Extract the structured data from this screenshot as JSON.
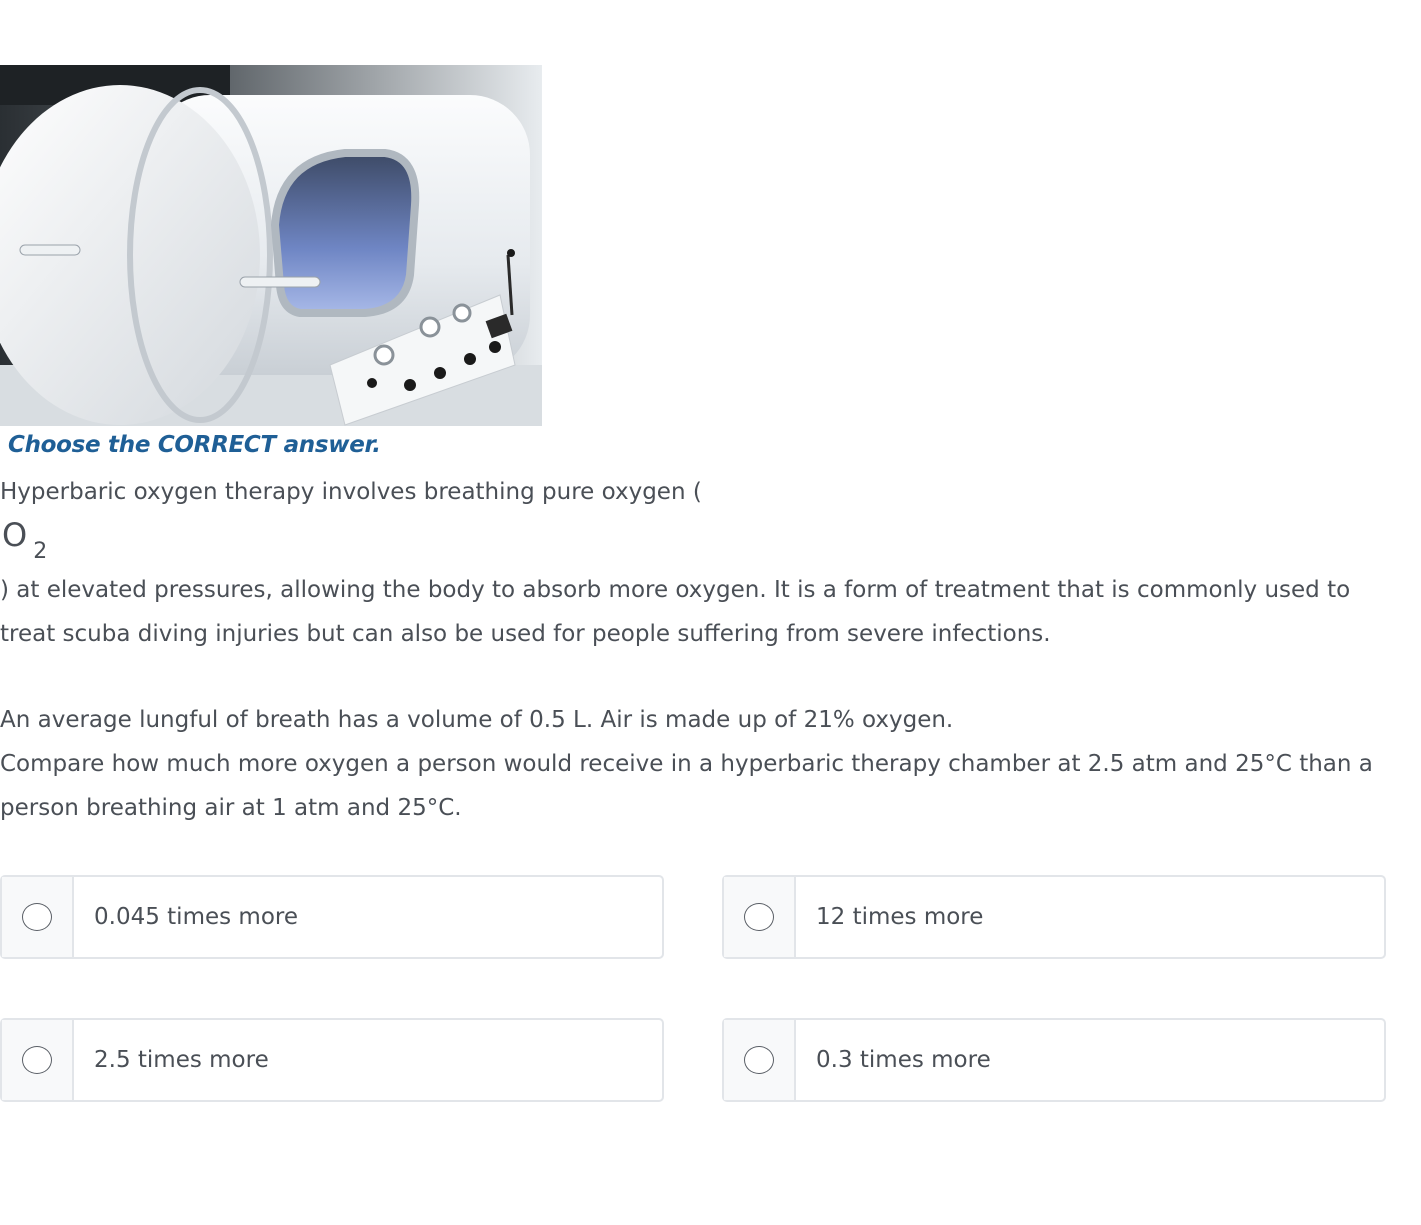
{
  "image": {
    "alt": "hyperbaric-chamber-photo"
  },
  "question": {
    "instruction": "Choose the CORRECT answer.",
    "intro": "Hyperbaric oxygen therapy involves breathing pure oxygen (",
    "formula_base": "O",
    "formula_sub": "2",
    "continuation": ") at elevated pressures, allowing the body to absorb more oxygen. It is a form of treatment that is commonly used to treat scuba diving injuries but can also be used for people suffering from severe infections.",
    "lung_info": "An average lungful of breath has a volume of 0.5 L. Air is made up of 21% oxygen.",
    "prompt": "Compare how much more oxygen a person would receive in a hyperbaric therapy chamber at 2.5 atm and 25°C than a person breathing air at 1 atm and 25°C."
  },
  "options": [
    {
      "label": "0.045 times more"
    },
    {
      "label": "12 times more"
    },
    {
      "label": "2.5 times more"
    },
    {
      "label": "0.3 times more"
    }
  ]
}
